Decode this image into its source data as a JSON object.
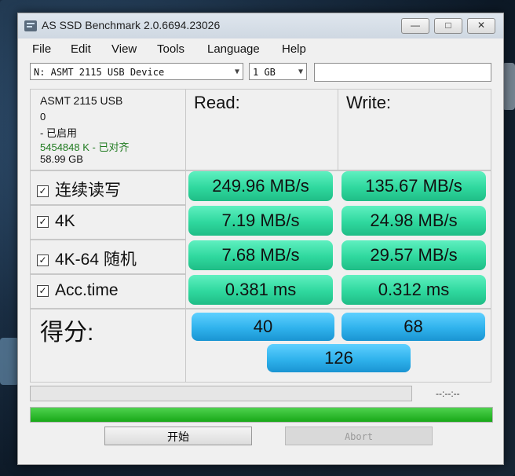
{
  "window": {
    "title": "AS SSD Benchmark 2.0.6694.23026",
    "minimize": "—",
    "maximize": "□",
    "close": "✕"
  },
  "menu": [
    "File",
    "Edit",
    "View",
    "Tools",
    "Language",
    "Help"
  ],
  "controls": {
    "drive_select": "N: ASMT 2115 USB Device",
    "size_select": "1 GB",
    "text_field": ""
  },
  "drive_info": {
    "name": "ASMT 2115 USB",
    "line2": "0",
    "status": " - 已启用",
    "alignment": "5454848 K - 已对齐",
    "capacity": "58.99 GB"
  },
  "columns": {
    "read": "Read:",
    "write": "Write:"
  },
  "tests": [
    {
      "label": "连续读写",
      "checked": true,
      "read": "249.96 MB/s",
      "write": "135.67 MB/s"
    },
    {
      "label": "4K",
      "checked": true,
      "read": "7.19 MB/s",
      "write": "24.98 MB/s"
    },
    {
      "label": "4K-64 随机",
      "checked": true,
      "read": "7.68 MB/s",
      "write": "29.57 MB/s"
    },
    {
      "label": "Acc.time",
      "checked": true,
      "read": "0.381 ms",
      "write": "0.312 ms"
    }
  ],
  "score": {
    "label": "得分:",
    "read": "40",
    "write": "68",
    "total": "126"
  },
  "progress": {
    "top_fraction": 0.0,
    "bottom_fraction": 1.0,
    "time": "--:--:--"
  },
  "buttons": {
    "start": "开始",
    "abort": "Abort"
  },
  "colors": {
    "result": "#2fd89e",
    "score": "#2fb2ec",
    "progress": "#18a818"
  }
}
